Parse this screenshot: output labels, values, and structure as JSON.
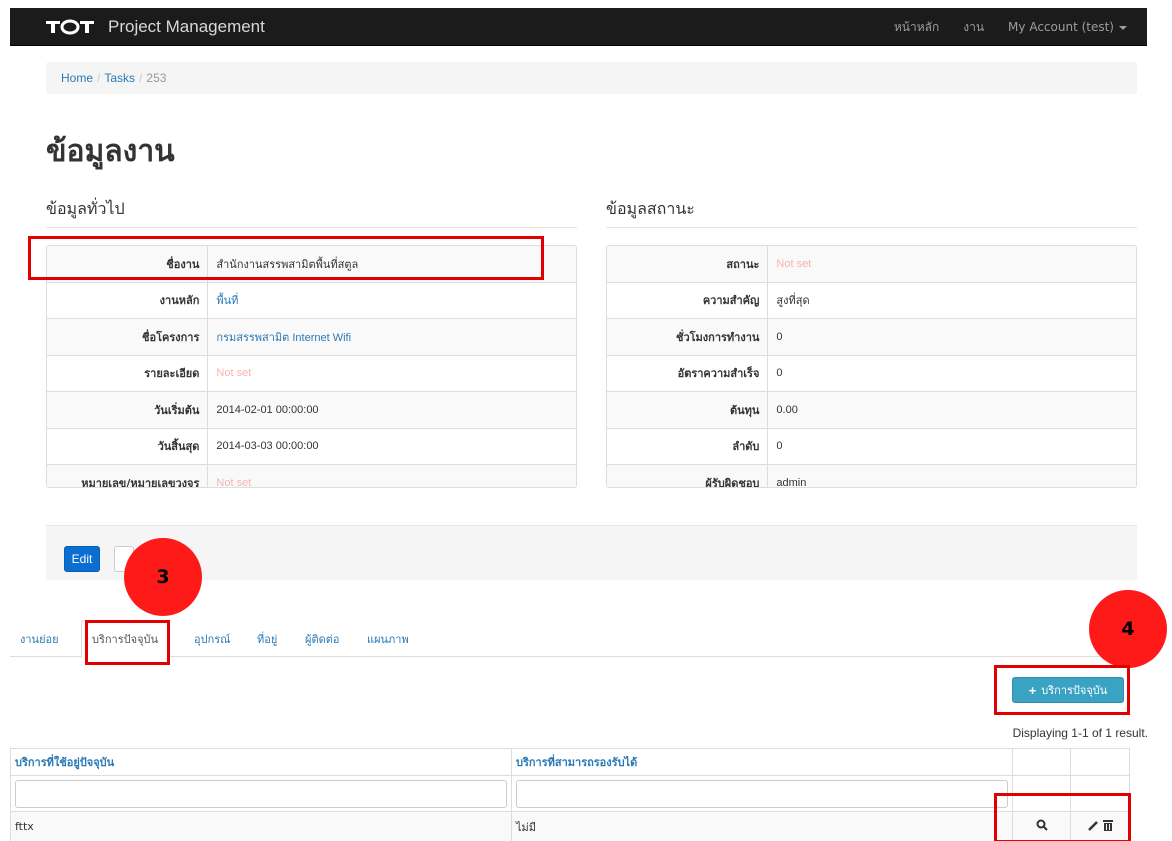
{
  "navbar": {
    "brand": "Project Management",
    "links": [
      "หน้าหลัก",
      "งาน",
      "My Account (test)"
    ]
  },
  "breadcrumb": {
    "home": "Home",
    "tasks": "Tasks",
    "current": "253"
  },
  "page_title": "ข้อมูลงาน",
  "general": {
    "title": "ข้อมูลทั่วไป",
    "rows": [
      {
        "label": "ชื่องาน",
        "value": "สำนักงานสรรพสามิตพื้นที่สตูล"
      },
      {
        "label": "งานหลัก",
        "value": "พื้นที่"
      },
      {
        "label": "ชื่อโครงการ",
        "value": "กรมสรรพสามิต Internet Wifi"
      },
      {
        "label": "รายละเอียด",
        "value": "Not set"
      },
      {
        "label": "วันเริ่มต้น",
        "value": "2014-02-01 00:00:00"
      },
      {
        "label": "วันสิ้นสุด",
        "value": "2014-03-03 00:00:00"
      },
      {
        "label": "หมายเลข/หมายเลขวงจร",
        "value": "Not set"
      }
    ]
  },
  "status": {
    "title": "ข้อมูลสถานะ",
    "rows": [
      {
        "label": "สถานะ",
        "value": "Not set"
      },
      {
        "label": "ความสำคัญ",
        "value": "สูงที่สุด"
      },
      {
        "label": "ชั่วโมงการทำงาน",
        "value": "0"
      },
      {
        "label": "อัตราความสำเร็จ",
        "value": "0"
      },
      {
        "label": "ต้นทุน",
        "value": "0.00"
      },
      {
        "label": "ลำดับ",
        "value": "0"
      },
      {
        "label": "ผู้รับผิดชอบ",
        "value": "admin"
      }
    ]
  },
  "actions": {
    "edit": "Edit"
  },
  "annotations": {
    "badge3": "3",
    "badge4": "4"
  },
  "tabs": [
    "งานย่อย",
    "บริการปัจจุบัน",
    "อุปกรณ์",
    "ที่อยู่",
    "ผู้ติดต่อ",
    "แผนภาพ"
  ],
  "add_button": "บริการปัจจุบัน",
  "summary": "Displaying 1-1 of 1 result.",
  "grid": {
    "headers": [
      "บริการที่ใช้อยู่ปัจจุบัน",
      "บริการที่สามารถรองรับได้"
    ],
    "rows": [
      {
        "current": "fttx",
        "supported": "ไม่มี"
      }
    ]
  },
  "icons": [
    "plus-icon",
    "search-icon",
    "pencil-icon",
    "trash-icon",
    "caret-down-icon"
  ],
  "colors": {
    "navbar": "#1b1b1b",
    "primary": "#0a6fd1",
    "info": "#3aa3c4",
    "link": "#2a7ab5",
    "notset": "#f8b3b3",
    "annotation": "#e00000"
  }
}
